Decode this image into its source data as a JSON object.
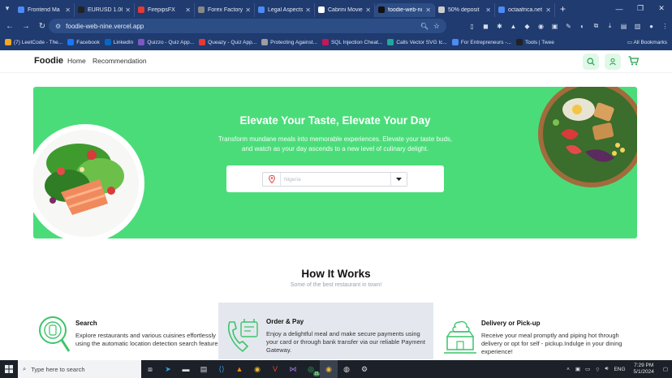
{
  "browser": {
    "tabs": [
      {
        "title": "Frontend Ma",
        "color": "#4c8bf5",
        "active": false
      },
      {
        "title": "EURUSD 1.06",
        "color": "#222222",
        "active": false
      },
      {
        "title": "FirepipsFX",
        "color": "#e53935",
        "active": false
      },
      {
        "title": "Forex Factory",
        "color": "#888888",
        "active": false
      },
      {
        "title": "Legal Aspects",
        "color": "#4c8bf5",
        "active": false
      },
      {
        "title": "Cabrini Movie",
        "color": "#ffffff",
        "active": false
      },
      {
        "title": "foodie-web-ni",
        "color": "#111111",
        "active": true
      },
      {
        "title": "50% deposit",
        "color": "#cccccc",
        "active": false
      },
      {
        "title": "octaafrica.net",
        "color": "#4c8bf5",
        "active": false
      }
    ],
    "url": "foodie-web-nine.vercel.app",
    "bookmarks": [
      {
        "label": "(7) LeetCode - The...",
        "color": "#f5a623"
      },
      {
        "label": "Facebook",
        "color": "#1877f2"
      },
      {
        "label": "LinkedIn",
        "color": "#0a66c2"
      },
      {
        "label": "Quizzo - Quiz App...",
        "color": "#7e57c2"
      },
      {
        "label": "Queazy - Quiz App...",
        "color": "#e53935"
      },
      {
        "label": "Protecting Against...",
        "color": "#9e9e9e"
      },
      {
        "label": "SQL Injection Cheat...",
        "color": "#c2185b"
      },
      {
        "label": "Calls Vector SVG Ic...",
        "color": "#26a69a"
      },
      {
        "label": "For Entrepreneurs -...",
        "color": "#4c8bf5"
      },
      {
        "label": "Tools | Twee",
        "color": "#222222"
      }
    ],
    "all_bookmarks": "All Bookmarks"
  },
  "site": {
    "logo": "Foodie",
    "nav": {
      "home": "Home",
      "recommendation": "Recommendation"
    },
    "accent": "#4bdc7a",
    "hero": {
      "title": "Elevate Your Taste, Elevate Your Day",
      "subtitle": "Transform mundane meals into memorable experiences. Elevate your taste buds, and watch as your day ascends to a new level of culinary delight.",
      "location_placeholder": "Nigeria"
    },
    "how": {
      "title": "How It Works",
      "subtitle": "Some of the best restaurant in town!",
      "cards": [
        {
          "title": "Search",
          "desc": "Explore restaurants and various cuisines effortlessly using the automatic location detection search feature"
        },
        {
          "title": "Order & Pay",
          "desc": "Enjoy a delightful meal and make secure payments using your card or through bank transfer via our reliable Payment Gateway."
        },
        {
          "title": "Delivery or Pick-up",
          "desc": "Receive your meal promptly and piping hot through delivery or opt for self - pickup.Indulge in your dining experience!"
        }
      ]
    }
  },
  "taskbar": {
    "search_placeholder": "Type here to search",
    "whatsapp_badge": "21",
    "lang": "ENG",
    "time": "7:29 PM",
    "date": "5/1/2024"
  }
}
